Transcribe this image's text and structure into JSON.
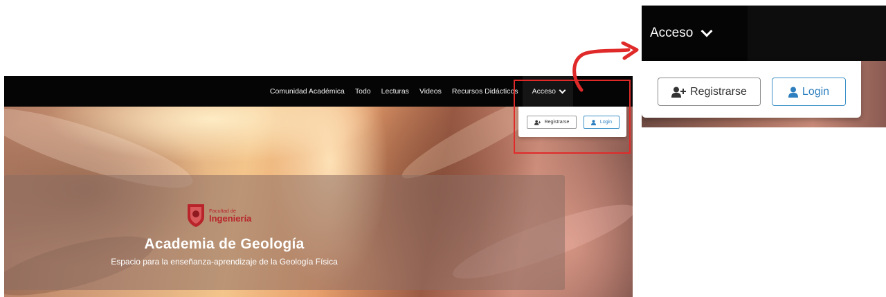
{
  "navbar": {
    "links": [
      {
        "label": "Comunidad Académica"
      },
      {
        "label": "Todo"
      },
      {
        "label": "Lecturas"
      },
      {
        "label": "Videos"
      },
      {
        "label": "Recursos Didácticos"
      }
    ],
    "acceso_label": "Acceso"
  },
  "dropdown": {
    "register_label": "Registrarse",
    "login_label": "Login"
  },
  "hero": {
    "logo_small": "Facultad de",
    "logo_big": "Ingeniería",
    "title": "Academia de Geología",
    "subtitle": "Espacio para la enseñanza-aprendizaje de la Geología Física"
  },
  "zoom": {
    "acceso_label": "Acceso",
    "register_label": "Registrarse",
    "login_label": "Login"
  },
  "colors": {
    "navbar_bg": "#050505",
    "highlight_red": "#e02a2a",
    "login_blue": "#2e7fbf",
    "logo_red": "#b8242a"
  },
  "icons": {
    "register": "user-plus-icon",
    "login": "user-icon",
    "acceso_chevron": "chevron-down-icon"
  }
}
